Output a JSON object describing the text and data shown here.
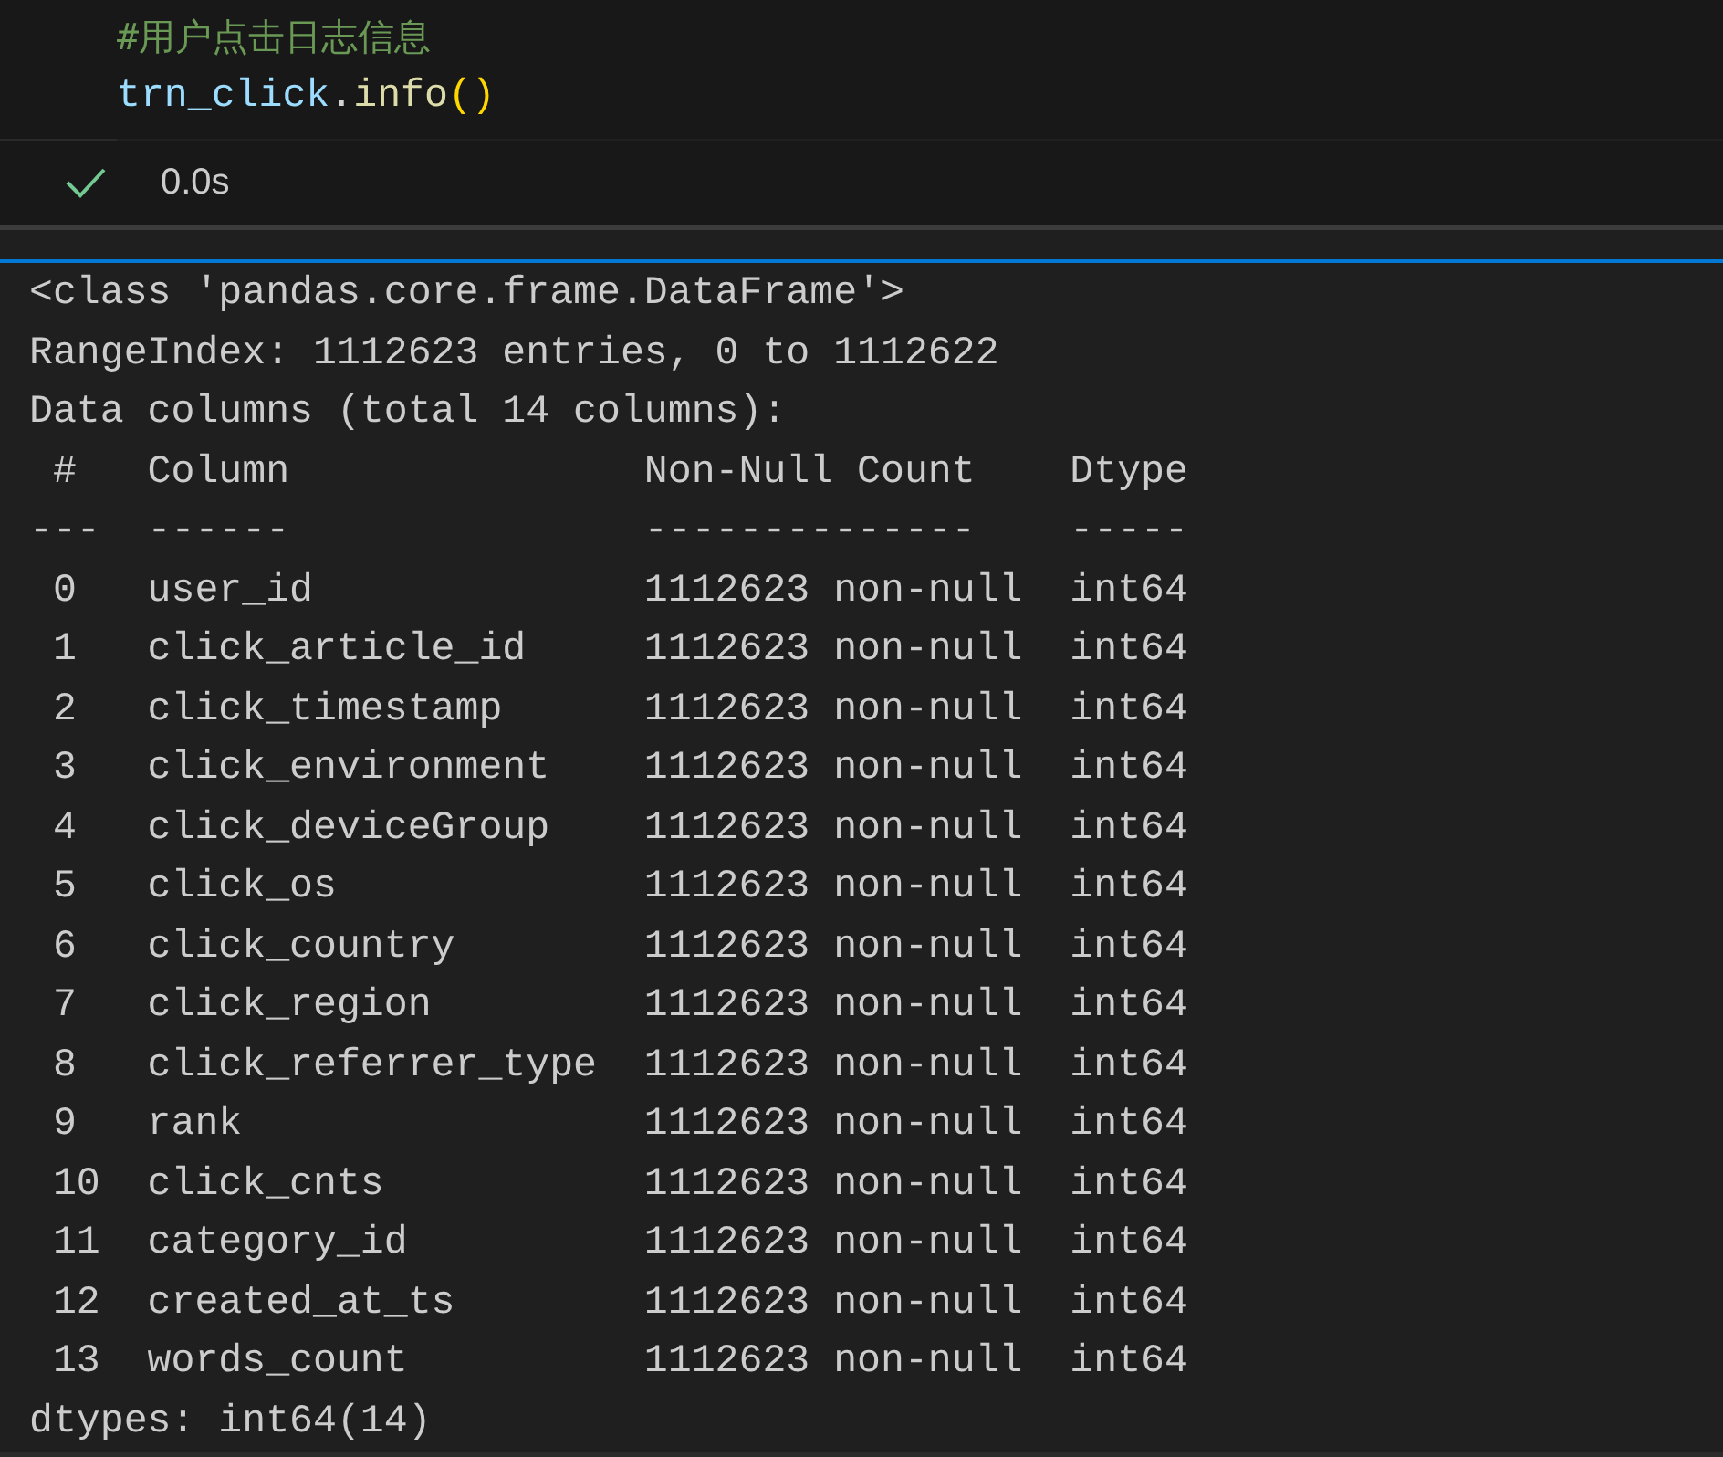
{
  "cell": {
    "code_lines": [
      [
        {
          "kind": "comment",
          "text": "#用户点击日志信息"
        }
      ],
      [
        {
          "kind": "variable",
          "text": "trn_click"
        },
        {
          "kind": "plain",
          "text": "."
        },
        {
          "kind": "function",
          "text": "info"
        },
        {
          "kind": "bracket",
          "text": "()"
        }
      ]
    ]
  },
  "status": {
    "success": true,
    "duration": "0.0s"
  },
  "output": {
    "lines": [
      "<class 'pandas.core.frame.DataFrame'>",
      "RangeIndex: 1112623 entries, 0 to 1112622",
      "Data columns (total 14 columns):",
      " #   Column               Non-Null Count    Dtype",
      "---  ------               --------------    -----",
      " 0   user_id              1112623 non-null  int64",
      " 1   click_article_id     1112623 non-null  int64",
      " 2   click_timestamp      1112623 non-null  int64",
      " 3   click_environment    1112623 non-null  int64",
      " 4   click_deviceGroup    1112623 non-null  int64",
      " 5   click_os             1112623 non-null  int64",
      " 6   click_country        1112623 non-null  int64",
      " 7   click_region         1112623 non-null  int64",
      " 8   click_referrer_type  1112623 non-null  int64",
      " 9   rank                 1112623 non-null  int64",
      " 10  click_cnts           1112623 non-null  int64",
      " 11  category_id          1112623 non-null  int64",
      " 12  created_at_ts        1112623 non-null  int64",
      " 13  words_count          1112623 non-null  int64",
      "dtypes: int64(14)"
    ]
  }
}
